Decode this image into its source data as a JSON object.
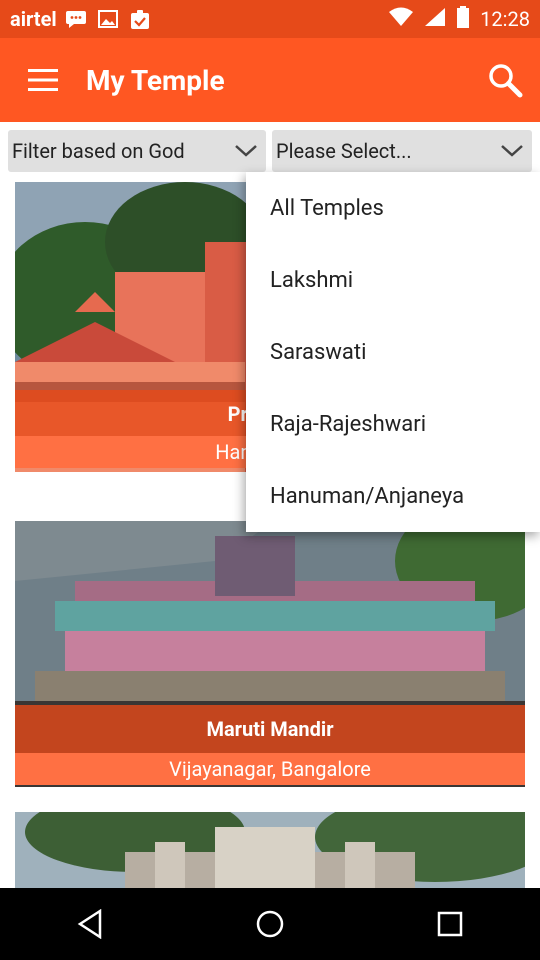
{
  "status": {
    "carrier": "airtel",
    "time": "12:28"
  },
  "appbar": {
    "title": "My Temple"
  },
  "filters": {
    "god_filter": "Filter based on God",
    "select": "Please Select..."
  },
  "dropdown": {
    "items": [
      "All Temples",
      "Lakshmi",
      "Saraswati",
      "Raja-Rajeshwari",
      "Hanuman/Anjaneya"
    ]
  },
  "cards": [
    {
      "name": "Prasanna",
      "location": "Hampinagar"
    },
    {
      "name": "Maruti Mandir",
      "location": "Vijayanagar, Bangalore"
    },
    {
      "name": "",
      "location": ""
    }
  ],
  "colors": {
    "statusbar": "#e64a19",
    "appbar": "#ff5722",
    "label": "#ff7043"
  }
}
